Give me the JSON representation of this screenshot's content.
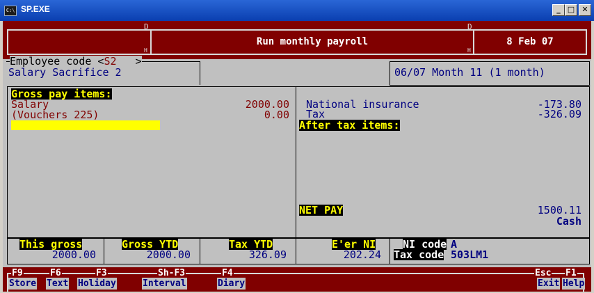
{
  "window": {
    "title": "SP.EXE",
    "app_icon": "C:\\",
    "min": "_",
    "max": "□",
    "close": "✕"
  },
  "header": {
    "title": "Run monthly payroll",
    "date": "8 Feb 07",
    "marker_d": "D",
    "marker_h": "H"
  },
  "employee": {
    "code_label": "Employee code <",
    "code_value": "S2",
    "code_close": ">",
    "name": "Salary Sacrifice 2"
  },
  "period": "06/07 Month 11 (1 month)",
  "gross_pay": {
    "heading": "Gross pay items:",
    "items": [
      {
        "label": "Salary",
        "value": "2000.00"
      },
      {
        "label": "(Vouchers 225)",
        "value": "0.00"
      }
    ]
  },
  "deductions": [
    {
      "label": "National insurance",
      "value": "-173.80"
    },
    {
      "label": "Tax",
      "value": "-326.09"
    }
  ],
  "after_tax": {
    "heading": "After tax items:"
  },
  "net_pay": {
    "label": "NET PAY",
    "value": "1500.11",
    "method": "Cash"
  },
  "totals": {
    "this_gross": {
      "label": "This gross",
      "value": "2000.00"
    },
    "gross_ytd": {
      "label": "Gross YTD",
      "value": "2000.00"
    },
    "tax_ytd": {
      "label": "Tax YTD",
      "value": "326.09"
    },
    "er_ni": {
      "label": "E'er NI",
      "value": "202.24"
    },
    "ni_code": {
      "label": "NI code",
      "value": "A"
    },
    "tax_code": {
      "label": "Tax code",
      "value": "503LM1"
    }
  },
  "function_keys": [
    {
      "key": "F9",
      "label": "Store"
    },
    {
      "key": "F6",
      "label": "Text"
    },
    {
      "key": "F3",
      "label": "Holiday"
    },
    {
      "key": "Sh-F3",
      "label": "Interval"
    },
    {
      "key": "F4",
      "label": "Diary"
    },
    {
      "key": "Esc",
      "label": "Exit"
    },
    {
      "key": "F1",
      "label": "Help"
    }
  ],
  "colors": {
    "maroon": "#800000",
    "navy": "#000080",
    "highlight_yellow": "#ffff00",
    "titlebar_blue": "#0a3fb0"
  }
}
